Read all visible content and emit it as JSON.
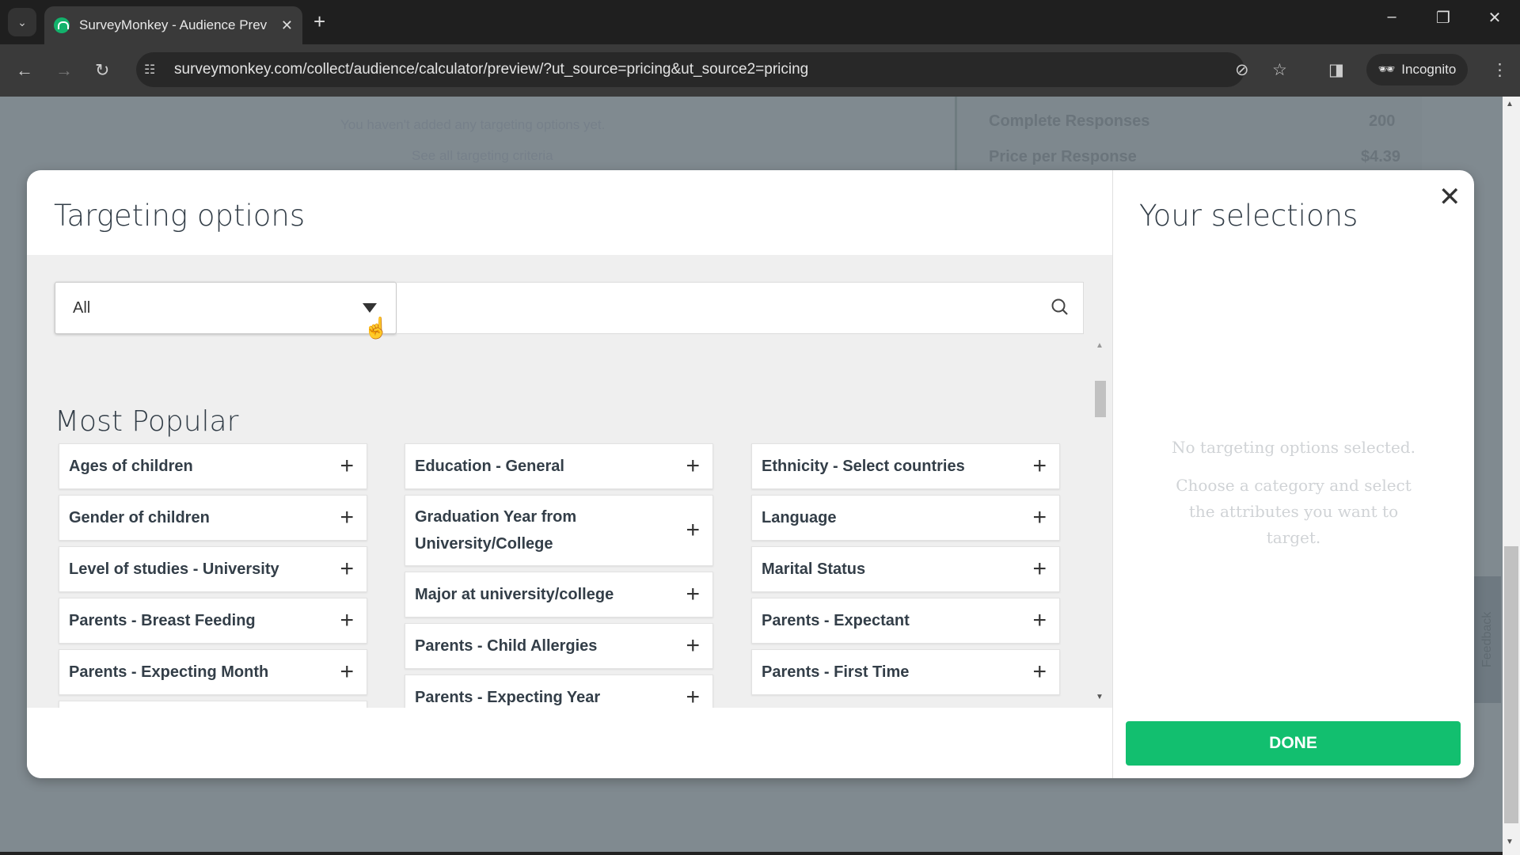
{
  "browser": {
    "tab_title": "SurveyMonkey - Audience Prev",
    "url": "surveymonkey.com/collect/audience/calculator/preview/?ut_source=pricing&ut_source2=pricing",
    "incognito_label": "Incognito"
  },
  "background": {
    "no_targeting_text": "You haven't added any targeting options yet.",
    "see_all_link": "See all targeting criteria",
    "complete_responses_label": "Complete Responses",
    "complete_responses_value": "200",
    "price_label": "Price per Response",
    "price_value": "$4.39",
    "feedback_label": "Feedback"
  },
  "modal": {
    "title": "Targeting options",
    "category_select": {
      "selected": "All"
    },
    "search": {
      "placeholder": "",
      "value": ""
    },
    "section_title": "Most Popular",
    "columns": [
      [
        "Ages of children",
        "Gender of children",
        "Level of studies - University",
        "Parents - Breast Feeding",
        "Parents - Expecting Month",
        ""
      ],
      [
        "Education - General",
        "Graduation Year from University/College",
        "Major at university/college",
        "Parents - Child Allergies",
        "Parents - Expecting Year"
      ],
      [
        "Ethnicity - Select countries",
        "Language",
        "Marital Status",
        "Parents - Expectant",
        "Parents - First Time"
      ]
    ],
    "selections_title": "Your selections",
    "empty_title": "No targeting options selected.",
    "empty_body": "Choose a category and select the attributes you want to target.",
    "done_label": "DONE"
  },
  "colors": {
    "accent": "#12bf6f",
    "overlay": "#808a90"
  }
}
